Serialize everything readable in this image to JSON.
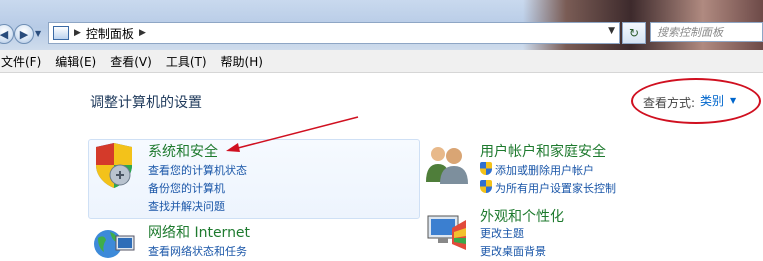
{
  "address": {
    "path": "控制面板",
    "search_placeholder": "搜索控制面板"
  },
  "menu": {
    "items": [
      "文件(F)",
      "编辑(E)",
      "查看(V)",
      "工具(T)",
      "帮助(H)"
    ]
  },
  "main": {
    "title": "调整计算机的设置",
    "view_label": "查看方式:",
    "view_value": "类别"
  },
  "categories": {
    "system_security": {
      "title": "系统和安全",
      "links": [
        "查看您的计算机状态",
        "备份您的计算机",
        "查找并解决问题"
      ]
    },
    "network": {
      "title": "网络和 Internet",
      "links": [
        "查看网络状态和任务"
      ]
    },
    "user_accounts": {
      "title": "用户帐户和家庭安全",
      "links": [
        "添加或删除用户帐户",
        "为所有用户设置家长控制"
      ]
    },
    "appearance": {
      "title": "外观和个性化",
      "links": [
        "更改主题",
        "更改桌面背景"
      ]
    }
  },
  "colors": {
    "annotation_red": "#d01020",
    "category_green": "#1e7a2e",
    "link_blue": "#1a56a8"
  }
}
